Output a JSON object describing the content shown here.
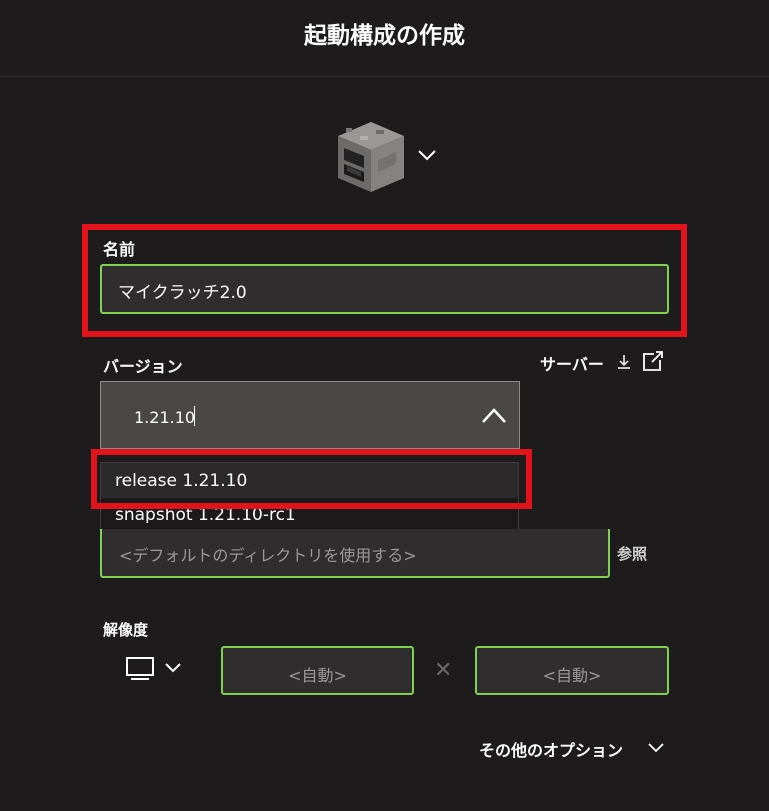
{
  "header": {
    "title": "起動構成の作成"
  },
  "icon": {
    "name": "furnace-icon"
  },
  "name_field": {
    "label": "名前",
    "value": "マイクラッチ2.0"
  },
  "version": {
    "label": "バージョン",
    "server_label": "サーバー",
    "selected": "1.21.10",
    "options": [
      "release 1.21.10",
      "snapshot 1.21.10-rc1"
    ]
  },
  "directory": {
    "placeholder": "<デフォルトのディレクトリを使用する>",
    "browse_label": "参照"
  },
  "resolution": {
    "label": "解像度",
    "width_placeholder": "<自動>",
    "height_placeholder": "<自動>"
  },
  "more_options": {
    "label": "その他のオプション"
  },
  "colors": {
    "accent": "#7fd14f",
    "highlight": "#e3131b",
    "background": "#1d1b1b"
  }
}
